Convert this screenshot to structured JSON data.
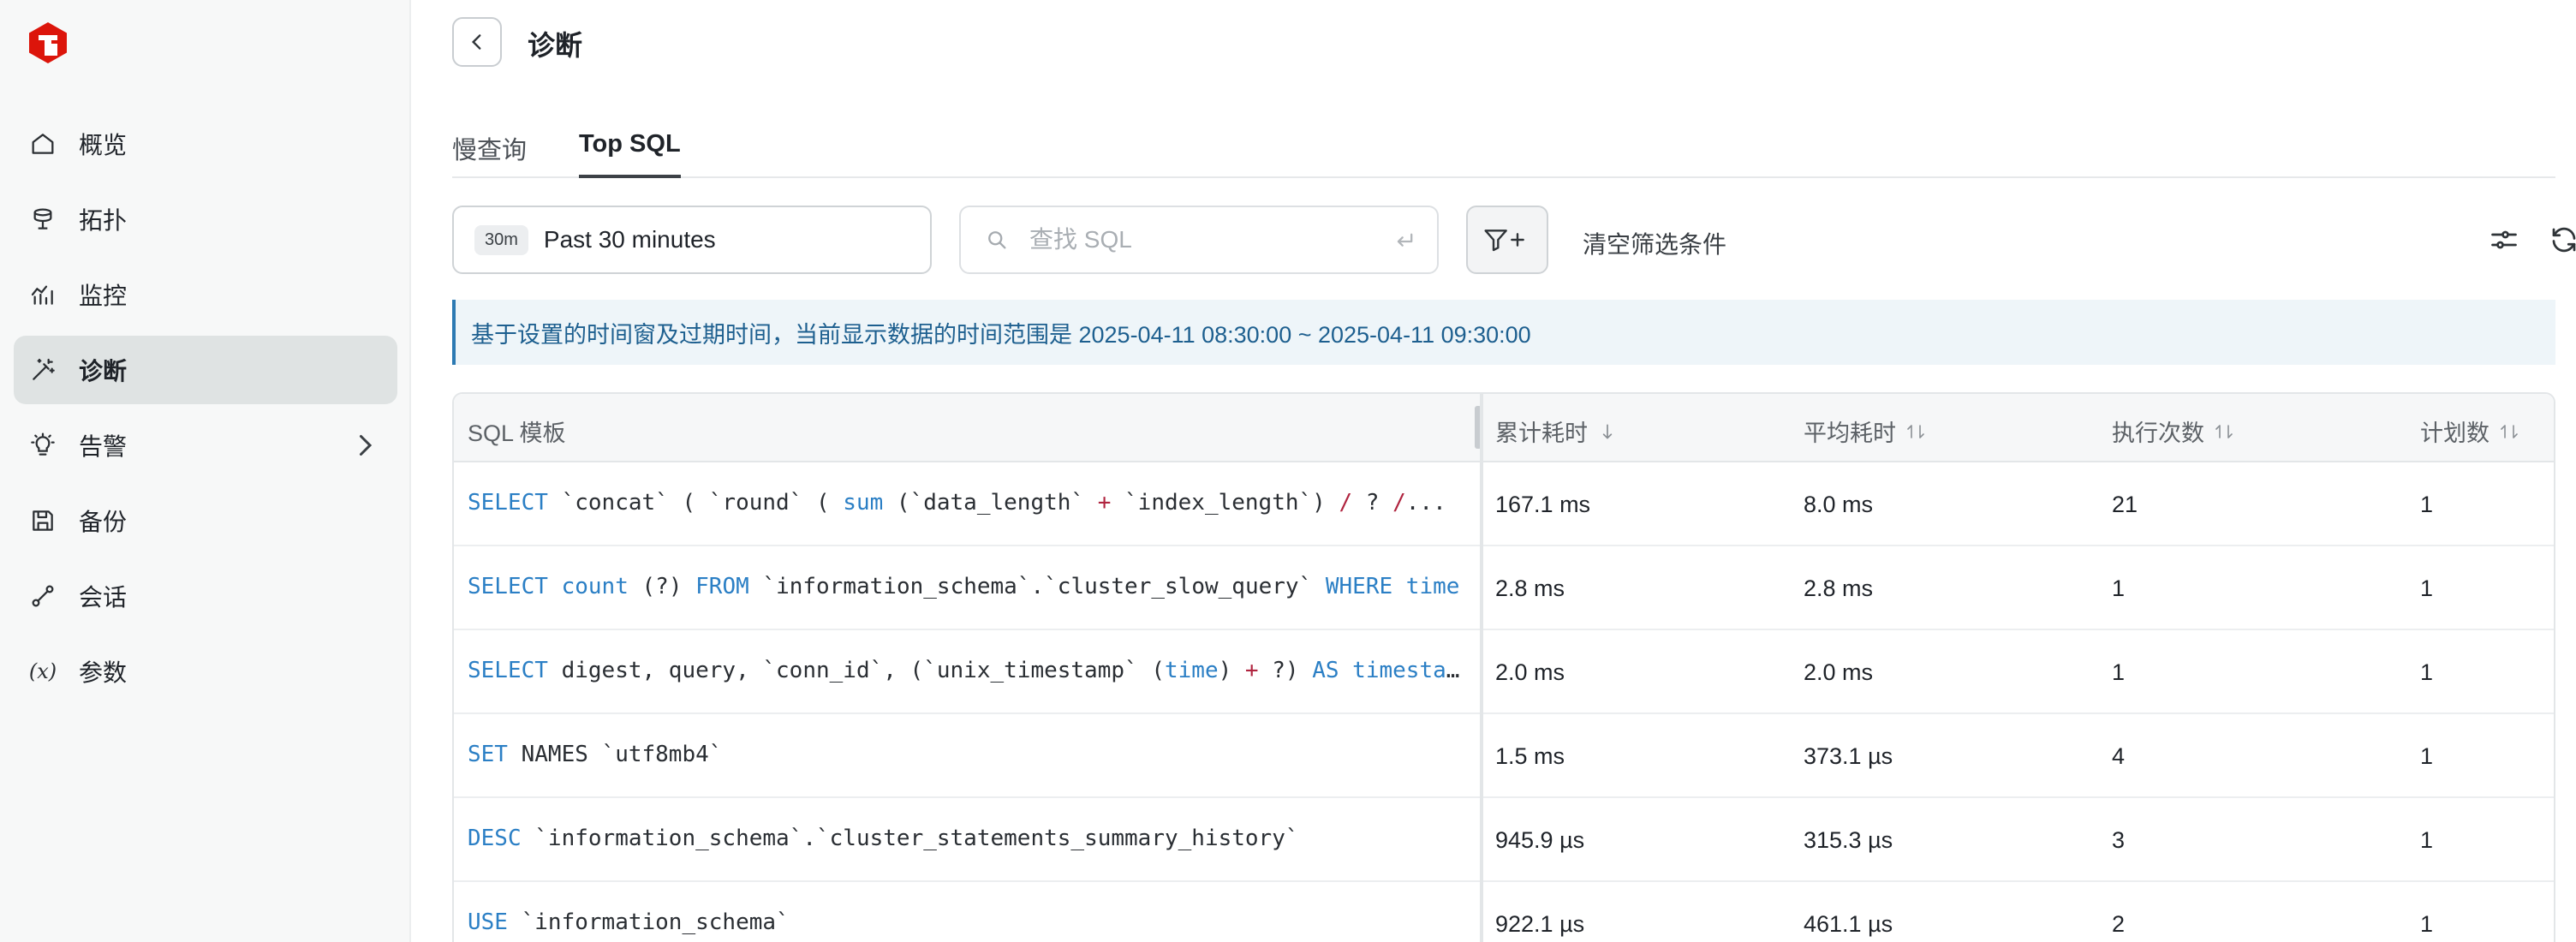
{
  "sidebar": {
    "items": [
      {
        "label": "概览",
        "icon": "home-icon"
      },
      {
        "label": "拓扑",
        "icon": "database-icon"
      },
      {
        "label": "监控",
        "icon": "monitor-icon"
      },
      {
        "label": "诊断",
        "icon": "magic-wand-icon",
        "active": true
      },
      {
        "label": "告警",
        "icon": "lightbulb-icon"
      },
      {
        "label": "备份",
        "icon": "save-icon"
      },
      {
        "label": "会话",
        "icon": "link-icon"
      },
      {
        "label": "参数",
        "icon": "variable-icon",
        "glyph": "(x)"
      }
    ]
  },
  "header": {
    "title": "诊断"
  },
  "tabs": [
    {
      "label": "慢查询"
    },
    {
      "label": "Top SQL",
      "active": true
    }
  ],
  "toolbar": {
    "time_badge": "30m",
    "time_label": "Past 30 minutes",
    "search_placeholder": "查找 SQL",
    "clear_filters": "清空筛选条件"
  },
  "banner": {
    "text": "基于设置的时间窗及过期时间，当前显示数据的时间范围是 2025-04-11 08:30:00 ~ 2025-04-11 09:30:00"
  },
  "table": {
    "headers": [
      "SQL 模板",
      "累计耗时",
      "平均耗时",
      "执行次数",
      "计划数"
    ],
    "rows": [
      {
        "sql": [
          [
            "kw",
            "SELECT"
          ],
          [
            "t",
            " `concat` ( `round` ( "
          ],
          [
            "kw",
            "sum"
          ],
          [
            "t",
            " (`data_length` "
          ],
          [
            "op",
            "+"
          ],
          [
            "t",
            " `index_length`) "
          ],
          [
            "op",
            "/"
          ],
          [
            "t",
            " ? "
          ],
          [
            "op",
            "/"
          ],
          [
            "t",
            "..."
          ]
        ],
        "total": "167.1 ms",
        "avg": "8.0 ms",
        "count": "21",
        "plans": "1"
      },
      {
        "sql": [
          [
            "kw",
            "SELECT"
          ],
          [
            "t",
            " "
          ],
          [
            "kw",
            "count"
          ],
          [
            "t",
            " (?) "
          ],
          [
            "kw",
            "FROM"
          ],
          [
            "t",
            " `information_schema`.`cluster_slow_query` "
          ],
          [
            "kw",
            "WHERE"
          ],
          [
            "t",
            " "
          ],
          [
            "kw",
            "time"
          ]
        ],
        "total": "2.8 ms",
        "avg": "2.8 ms",
        "count": "1",
        "plans": "1"
      },
      {
        "sql": [
          [
            "kw",
            "SELECT"
          ],
          [
            "t",
            " digest, query, `conn_id`, (`unix_timestamp` ("
          ],
          [
            "kw",
            "time"
          ],
          [
            "t",
            ") "
          ],
          [
            "op",
            "+"
          ],
          [
            "t",
            " ?) "
          ],
          [
            "kw",
            "AS"
          ],
          [
            "t",
            " "
          ],
          [
            "kw",
            "timestamp"
          ]
        ],
        "total": "2.0 ms",
        "avg": "2.0 ms",
        "count": "1",
        "plans": "1"
      },
      {
        "sql": [
          [
            "kw",
            "SET"
          ],
          [
            "t",
            " NAMES `utf8mb4`"
          ]
        ],
        "total": "1.5 ms",
        "avg": "373.1 µs",
        "count": "4",
        "plans": "1"
      },
      {
        "sql": [
          [
            "kw",
            "DESC"
          ],
          [
            "t",
            " `information_schema`.`cluster_statements_summary_history`"
          ]
        ],
        "total": "945.9 µs",
        "avg": "315.3 µs",
        "count": "3",
        "plans": "1"
      },
      {
        "sql": [
          [
            "kw",
            "USE"
          ],
          [
            "t",
            " `information_schema`"
          ]
        ],
        "total": "922.1 µs",
        "avg": "461.1 µs",
        "count": "2",
        "plans": "1"
      }
    ]
  }
}
